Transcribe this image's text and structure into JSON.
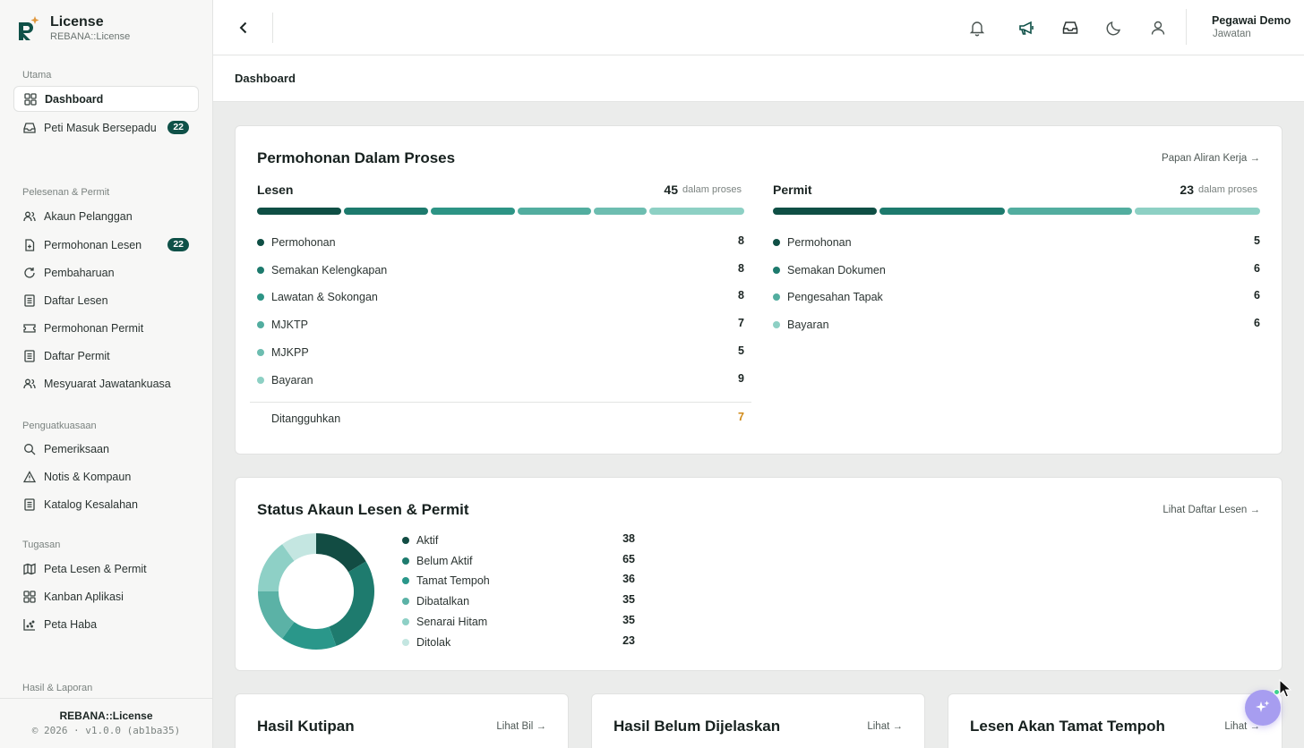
{
  "brand": {
    "title": "License",
    "subtitle": "REBANA::License"
  },
  "sidebar": {
    "sections": [
      {
        "label": "Utama"
      },
      {
        "label": "Pelesenan & Permit"
      },
      {
        "label": "Penguatkuasaan"
      },
      {
        "label": "Tugasan"
      },
      {
        "label": "Hasil & Laporan"
      }
    ],
    "items": [
      {
        "label": "Dashboard",
        "icon": "grid-icon"
      },
      {
        "label": "Peti Masuk Bersepadu",
        "icon": "inbox-icon",
        "badge": "22"
      },
      {
        "label": "Akaun Pelanggan",
        "icon": "users-icon"
      },
      {
        "label": "Permohonan Lesen",
        "icon": "file-plus-icon",
        "badge": "22"
      },
      {
        "label": "Pembaharuan",
        "icon": "refresh-icon"
      },
      {
        "label": "Daftar Lesen",
        "icon": "list-icon"
      },
      {
        "label": "Permohonan Permit",
        "icon": "ticket-icon"
      },
      {
        "label": "Daftar Permit",
        "icon": "list-icon"
      },
      {
        "label": "Mesyuarat Jawatankuasa",
        "icon": "users-icon"
      },
      {
        "label": "Pemeriksaan",
        "icon": "search-icon"
      },
      {
        "label": "Notis & Kompaun",
        "icon": "warning-icon"
      },
      {
        "label": "Katalog Kesalahan",
        "icon": "list-icon"
      },
      {
        "label": "Peta Lesen & Permit",
        "icon": "map-icon"
      },
      {
        "label": "Kanban Aplikasi",
        "icon": "grid-icon"
      },
      {
        "label": "Peta Haba",
        "icon": "scatter-icon"
      }
    ],
    "footer": {
      "name": "REBANA::License",
      "version": "© 2026 · v1.0.0 (ab1ba35)"
    }
  },
  "topbar": {
    "user_name": "Pegawai Demo",
    "user_role": "Jawatan"
  },
  "breadcrumb": "Dashboard",
  "colors": {
    "accent": "#0f5148",
    "pending": "#d08a18"
  },
  "proses": {
    "title": "Permohonan Dalam Proses",
    "link": "Papan Aliran Kerja →",
    "lesen": {
      "title": "Lesen",
      "count": "45",
      "count_label": "dalam proses",
      "rows": [
        {
          "label": "Permohonan",
          "value": "8",
          "color": "#0f4f45"
        },
        {
          "label": "Semakan Kelengkapan",
          "value": "8",
          "color": "#1d7a6d"
        },
        {
          "label": "Lawatan & Sokongan",
          "value": "8",
          "color": "#2d9485"
        },
        {
          "label": "MJKTP",
          "value": "7",
          "color": "#52ad9f"
        },
        {
          "label": "MJKPP",
          "value": "5",
          "color": "#6dbdb0"
        },
        {
          "label": "Bayaran",
          "value": "9",
          "color": "#8dd0c4"
        }
      ],
      "suspended_label": "Ditangguhkan",
      "suspended_value": "7"
    },
    "permit": {
      "title": "Permit",
      "count": "23",
      "count_label": "dalam proses",
      "rows": [
        {
          "label": "Permohonan",
          "value": "5",
          "color": "#0f4f45"
        },
        {
          "label": "Semakan Dokumen",
          "value": "6",
          "color": "#1d7a6d"
        },
        {
          "label": "Pengesahan Tapak",
          "value": "6",
          "color": "#52ad9f"
        },
        {
          "label": "Bayaran",
          "value": "6",
          "color": "#8dd0c4"
        }
      ]
    }
  },
  "status": {
    "title": "Status Akaun Lesen & Permit",
    "link": "Lihat Daftar Lesen →",
    "rows": [
      {
        "label": "Aktif",
        "value": "38",
        "color": "#124c43"
      },
      {
        "label": "Belum Aktif",
        "value": "65",
        "color": "#1e7b6e"
      },
      {
        "label": "Tamat Tempoh",
        "value": "36",
        "color": "#2a978a"
      },
      {
        "label": "Dibatalkan",
        "value": "35",
        "color": "#5bb2a6"
      },
      {
        "label": "Senarai Hitam",
        "value": "35",
        "color": "#8ed0c6"
      },
      {
        "label": "Ditolak",
        "value": "23",
        "color": "#c4e6e1"
      }
    ]
  },
  "bottom_cards": [
    {
      "title": "Hasil Kutipan",
      "link": "Lihat Bil →"
    },
    {
      "title": "Hasil Belum Dijelaskan",
      "link": "Lihat →"
    },
    {
      "title": "Lesen Akan Tamat Tempoh",
      "link": "Lihat →"
    }
  ]
}
